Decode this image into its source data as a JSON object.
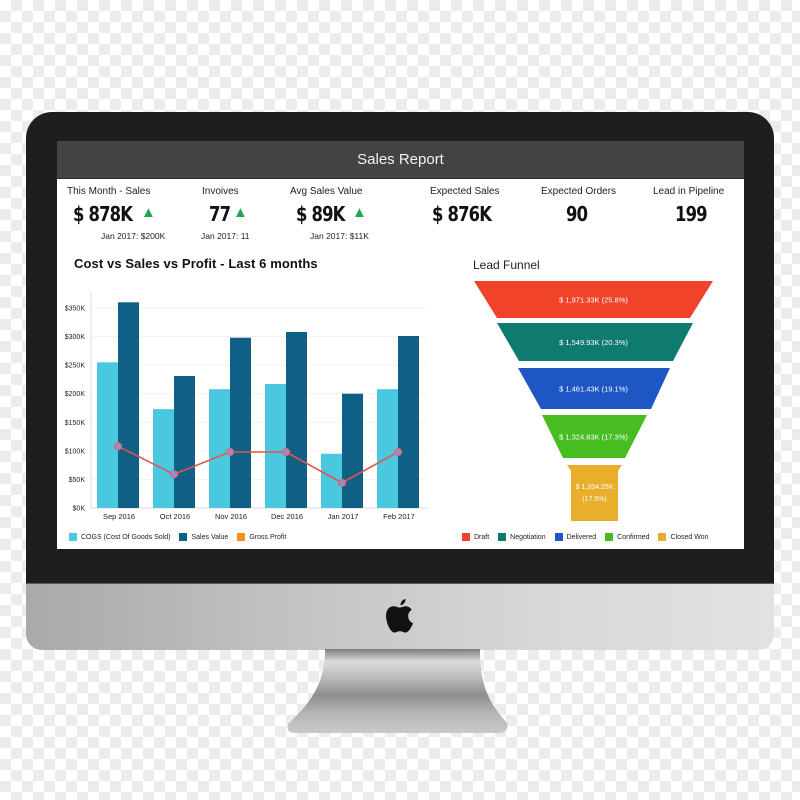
{
  "window": {
    "title": "Sales Report"
  },
  "kpis": [
    {
      "label": "This Month - Sales",
      "value": "$ 878K",
      "trend": "up",
      "sub": "Jan 2017: $200K"
    },
    {
      "label": "Invoives",
      "value": "77",
      "trend": "up",
      "sub": "Jan 2017: 11"
    },
    {
      "label": "Avg Sales Value",
      "value": "$ 89K",
      "trend": "up",
      "sub": "Jan 2017: $11K"
    },
    {
      "label": "Expected Sales",
      "value": "$ 876K"
    },
    {
      "label": "Expected Orders",
      "value": "90"
    },
    {
      "label": "Lead in Pipeline",
      "value": "199"
    }
  ],
  "icons": {
    "trend_up": "▲"
  },
  "colors": {
    "cogs": "#4ac8e0",
    "sales": "#0f5f86",
    "profit": "#e2554a",
    "profit_legend": "#f5921e",
    "draft": "#f0432a",
    "negotiation": "#0e7a70",
    "delivered": "#1e56c4",
    "confirmed": "#48bd22",
    "closed_won": "#e8ae2c",
    "trend_up": "#1fa84f"
  },
  "chart_data": [
    {
      "type": "bar",
      "title": "Cost vs Sales vs Profit - Last 6 months",
      "categories": [
        "Sep 2016",
        "Oct 2016",
        "Nov 2016",
        "Dec 2016",
        "Jan 2017",
        "Feb 2017"
      ],
      "series": [
        {
          "name": "COGS (Cost Of Goods Sold)",
          "kind": "bar",
          "values": [
            255,
            173,
            208,
            217,
            95,
            208
          ]
        },
        {
          "name": "Sales Value",
          "kind": "bar",
          "values": [
            360,
            231,
            298,
            308,
            200,
            301
          ]
        },
        {
          "name": "Gross Profit",
          "kind": "line",
          "values": [
            108,
            59,
            98,
            98,
            44,
            98
          ]
        }
      ],
      "units": "$K",
      "yticks": [
        "$0K",
        "$50K",
        "$100K",
        "$150K",
        "$200K",
        "$250K",
        "$300K",
        "$350K"
      ],
      "ylim": [
        0,
        350
      ],
      "grid": true,
      "legend": "bottom-left"
    },
    {
      "type": "funnel",
      "title": "Lead Funnel",
      "stages": [
        {
          "name": "Draft",
          "label": "$ 1,971.33K (25.8%)",
          "value": 1971.33,
          "percent": 25.8
        },
        {
          "name": "Negotiation",
          "label": "$ 1,549.93K (20.3%)",
          "value": 1549.93,
          "percent": 20.3
        },
        {
          "name": "Delivered",
          "label": "$ 1,461.43K (19.1%)",
          "value": 1461.43,
          "percent": 19.1
        },
        {
          "name": "Confirmed",
          "label": "$ 1,324.83K (17.3%)",
          "value": 1324.83,
          "percent": 17.3
        },
        {
          "name": "Closed Won",
          "label_line1": "$ 1,334.25K",
          "label_line2": "(17.5%)",
          "value": 1334.25,
          "percent": 17.5
        }
      ],
      "legend": "bottom"
    }
  ]
}
